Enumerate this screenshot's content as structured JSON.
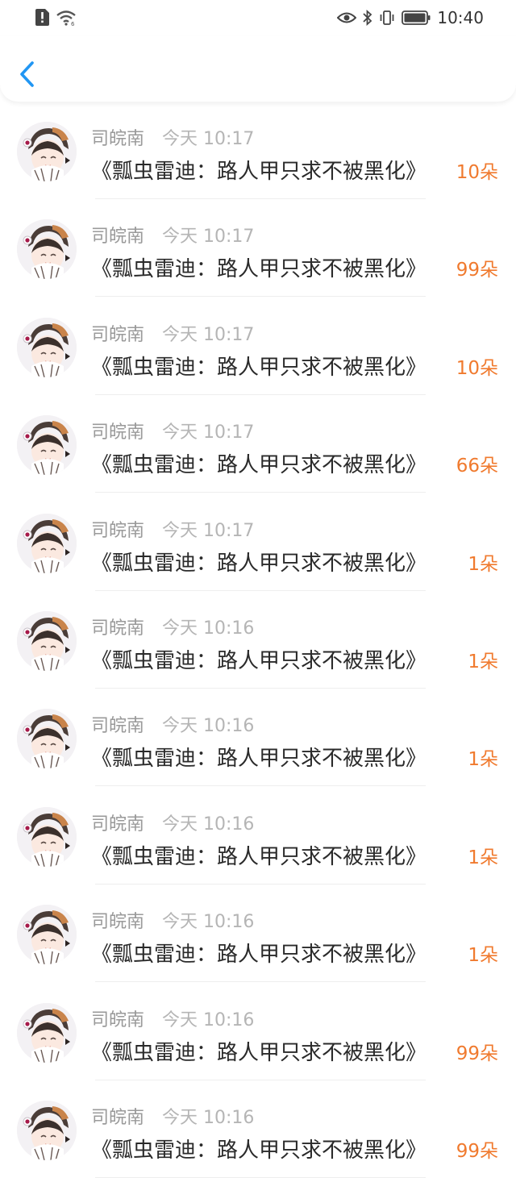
{
  "status_bar": {
    "time": "10:40",
    "icons_left": [
      "alert-sim-icon",
      "wifi-icon"
    ],
    "icons_right": [
      "eye-icon",
      "bluetooth-icon",
      "vibrate-icon",
      "battery-icon"
    ]
  },
  "nav": {
    "back_icon": "chevron-left-icon"
  },
  "colors": {
    "accent_blue": "#2196f3",
    "count_orange": "#f07a2e",
    "name_gray": "#9a9a9a"
  },
  "items": [
    {
      "name": "司皖南",
      "time": "今天 10:17",
      "title": "《瓢虫雷迪：路人甲只求不被黑化》",
      "count": "10朵"
    },
    {
      "name": "司皖南",
      "time": "今天 10:17",
      "title": "《瓢虫雷迪：路人甲只求不被黑化》",
      "count": "99朵"
    },
    {
      "name": "司皖南",
      "time": "今天 10:17",
      "title": "《瓢虫雷迪：路人甲只求不被黑化》",
      "count": "10朵"
    },
    {
      "name": "司皖南",
      "time": "今天 10:17",
      "title": "《瓢虫雷迪：路人甲只求不被黑化》",
      "count": "66朵"
    },
    {
      "name": "司皖南",
      "time": "今天 10:17",
      "title": "《瓢虫雷迪：路人甲只求不被黑化》",
      "count": "1朵"
    },
    {
      "name": "司皖南",
      "time": "今天 10:16",
      "title": "《瓢虫雷迪：路人甲只求不被黑化》",
      "count": "1朵"
    },
    {
      "name": "司皖南",
      "time": "今天 10:16",
      "title": "《瓢虫雷迪：路人甲只求不被黑化》",
      "count": "1朵"
    },
    {
      "name": "司皖南",
      "time": "今天 10:16",
      "title": "《瓢虫雷迪：路人甲只求不被黑化》",
      "count": "1朵"
    },
    {
      "name": "司皖南",
      "time": "今天 10:16",
      "title": "《瓢虫雷迪：路人甲只求不被黑化》",
      "count": "1朵"
    },
    {
      "name": "司皖南",
      "time": "今天 10:16",
      "title": "《瓢虫雷迪：路人甲只求不被黑化》",
      "count": "99朵"
    },
    {
      "name": "司皖南",
      "time": "今天 10:16",
      "title": "《瓢虫雷迪：路人甲只求不被黑化》",
      "count": "99朵"
    }
  ]
}
